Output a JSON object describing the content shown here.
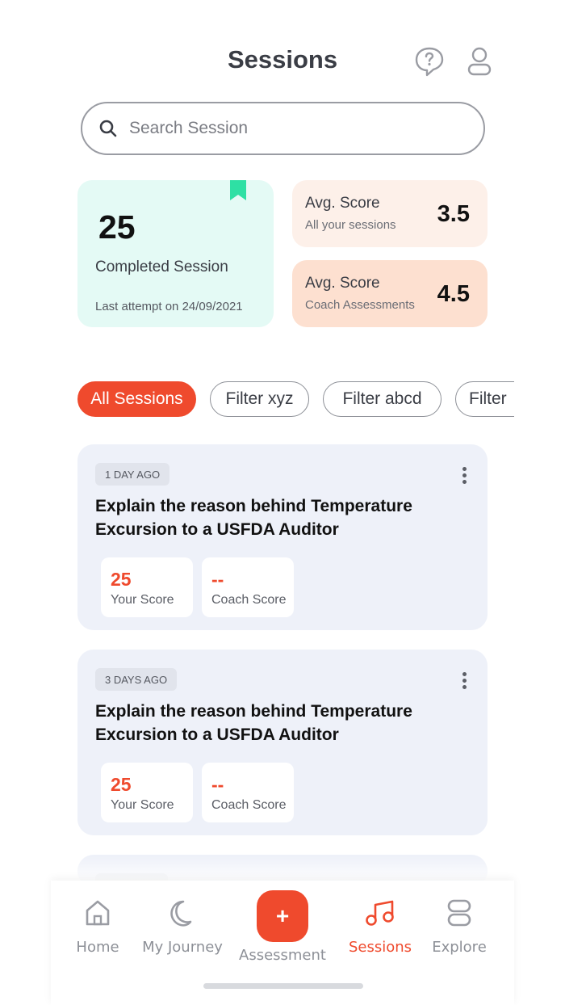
{
  "header": {
    "title": "Sessions",
    "help_icon": "help-chat-icon",
    "profile_icon": "profile-icon"
  },
  "search": {
    "placeholder": "Search Session",
    "value": ""
  },
  "stats": {
    "completed_count": "25",
    "completed_label": "Completed Session",
    "last_attempt": "Last attempt on 24/09/2021",
    "avg_all": {
      "title": "Avg. Score",
      "subtitle": "All your sessions",
      "value": "3.5"
    },
    "avg_coach": {
      "title": "Avg. Score",
      "subtitle": "Coach Assessments",
      "value": "4.5"
    }
  },
  "filters": [
    "All Sessions",
    "Filter xyz",
    "Filter abcd",
    "Filter"
  ],
  "sessions": [
    {
      "time": "1 DAY AGO",
      "title": "Explain the reason behind Temperature Excursion to a USFDA Auditor",
      "your_score": "25",
      "your_score_label": "Your Score",
      "coach_score": "--",
      "coach_score_label": "Coach Score"
    },
    {
      "time": "3 DAYS AGO",
      "title": "Explain the reason behind Temperature Excursion to a USFDA Auditor",
      "your_score": "25",
      "your_score_label": "Your Score",
      "coach_score": "--",
      "coach_score_label": "Coach Score"
    }
  ],
  "nav": {
    "home": "Home",
    "journey": "My Journey",
    "fab_symbol": "+",
    "assessment": "Assessment",
    "sessions": "Sessions",
    "explore": "Explore"
  },
  "colors": {
    "accent": "#ef4a2d",
    "completed_bg": "#e4faf5",
    "bookmark": "#2ee0a4",
    "avg1_bg": "#fdf0e9",
    "avg2_bg": "#fde0d0",
    "card_bg": "#eef1f9"
  }
}
